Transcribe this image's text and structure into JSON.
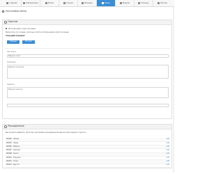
{
  "tabs": [
    {
      "label": "Главная",
      "icon": "home-icon",
      "active": false
    },
    {
      "label": "Оформление",
      "icon": "brush-icon",
      "active": false
    },
    {
      "label": "Блоки",
      "icon": "blocks-icon",
      "active": false
    },
    {
      "label": "Ссылки",
      "icon": "link-icon",
      "active": false
    },
    {
      "label": "Размеры",
      "icon": "resize-icon",
      "active": false
    },
    {
      "label": "Меню",
      "icon": "menu-icon",
      "active": true
    },
    {
      "label": "Модули",
      "icon": "module-icon",
      "active": false
    },
    {
      "label": "Помощь",
      "icon": "help-icon",
      "active": false
    },
    {
      "label": "Прочее",
      "icon": "more-icon",
      "active": false
    }
  ],
  "header": {
    "title": "Настройки меню"
  },
  "simple": {
    "title": "Простое",
    "option1": "Использовать простое меню",
    "option2": "Включить эту опцию, если вы хотите использовать простое меню",
    "current_label": "Текущий порядок:",
    "btn1": "Первый",
    "btn2": "Второй",
    "field1_label": "Заголовок",
    "field1_placeholder": "Введите текст",
    "field2_label": "Описание",
    "field2_placeholder": "Введите описание",
    "field3_label": "Заметка",
    "field3_placeholder": "Введите заметку"
  },
  "advanced": {
    "title": "Расширенные",
    "desc": "Вы можете выбрать. Простые настройки расширенной версии для каждого пункта.",
    "rows": [
      {
        "id": "#1002",
        "name": "Общие",
        "action": "edit"
      },
      {
        "id": "#1004",
        "name": "Обувь",
        "action": "edit"
      },
      {
        "id": "#1005",
        "name": "Мебель",
        "action": "edit"
      },
      {
        "id": "#1007",
        "name": "Одежда",
        "action": "edit"
      },
      {
        "id": "#1008",
        "name": "Книги",
        "action": "edit"
      },
      {
        "id": "#1010",
        "name": "Игрушки",
        "action": "edit"
      },
      {
        "id": "#1012",
        "name": "Спорт",
        "action": "edit"
      },
      {
        "id": "#1014",
        "name": "Другое",
        "action": "edit"
      }
    ]
  },
  "colors": {
    "accent": "#3b8dd4"
  }
}
